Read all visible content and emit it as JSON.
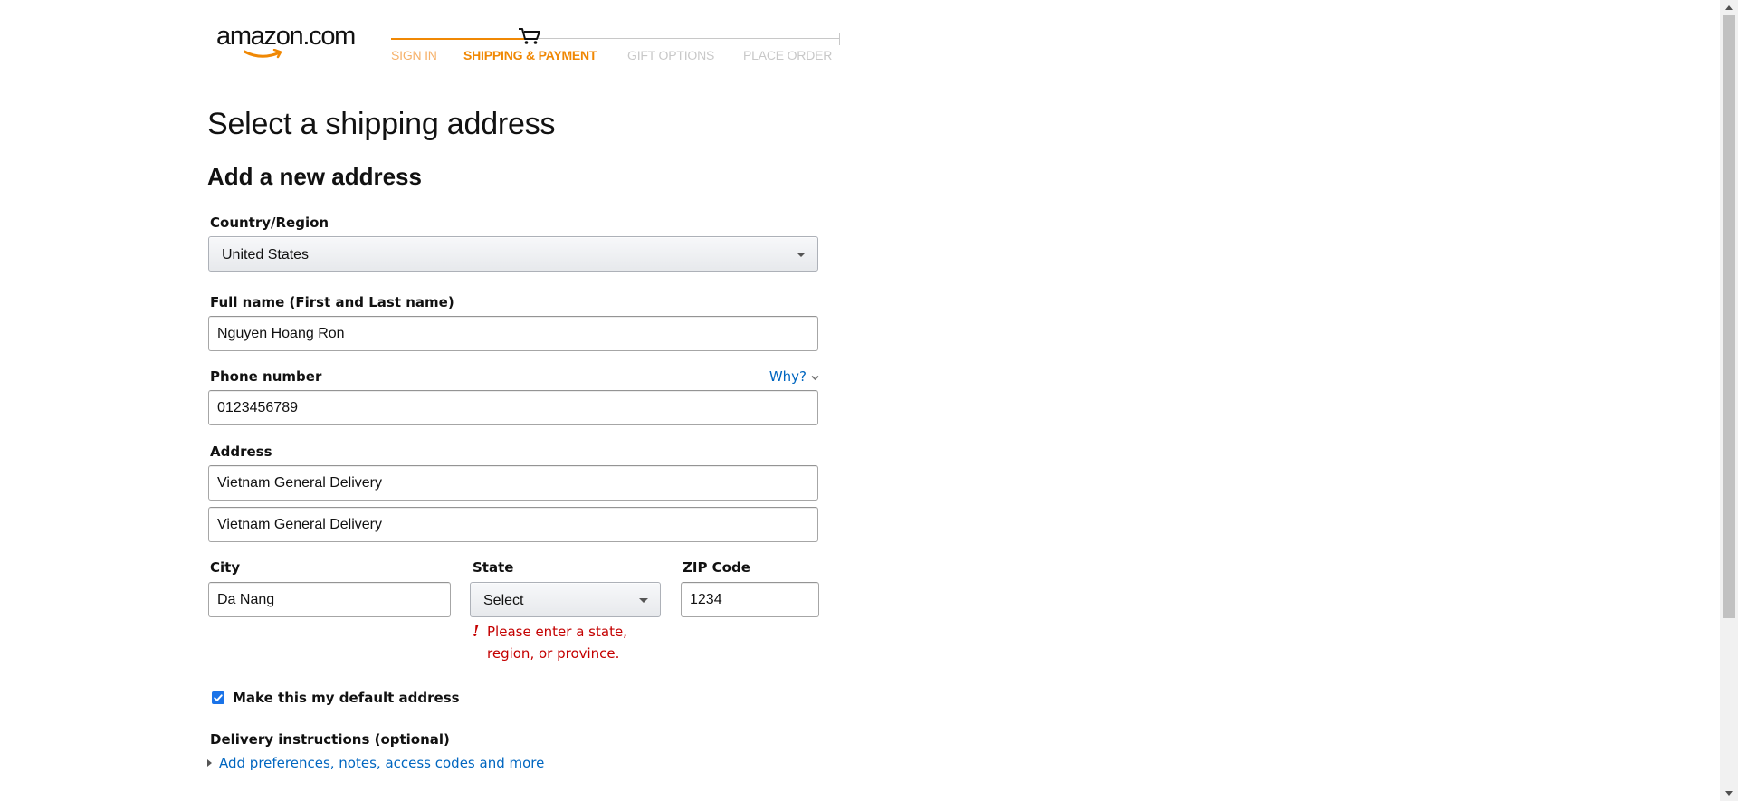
{
  "header": {
    "logo_text": "amazon.com",
    "steps": [
      "SIGN IN",
      "SHIPPING & PAYMENT",
      "GIFT OPTIONS",
      "PLACE ORDER"
    ],
    "cart_icon": "cart-icon"
  },
  "page": {
    "title": "Select a shipping address",
    "subtitle": "Add a new address"
  },
  "form": {
    "country": {
      "label": "Country/Region",
      "value": "United States"
    },
    "full_name": {
      "label": "Full name (First and Last name)",
      "value": "Nguyen Hoang Ron"
    },
    "phone": {
      "label": "Phone number",
      "value": "0123456789",
      "help_link": "Why?"
    },
    "address": {
      "label": "Address",
      "line1": "Vietnam General Delivery",
      "line2": "Vietnam General Delivery"
    },
    "city": {
      "label": "City",
      "value": "Da Nang"
    },
    "state": {
      "label": "State",
      "value": "Select",
      "error": "Please enter a state, region, or province."
    },
    "zip": {
      "label": "ZIP Code",
      "value": "1234"
    },
    "default_address": {
      "label": "Make this my default address",
      "checked": true
    },
    "delivery": {
      "label": "Delivery instructions (optional)",
      "link": "Add preferences, notes, access codes and more"
    }
  },
  "colors": {
    "accent": "#f08804",
    "link": "#0066c0",
    "error": "#c40000",
    "checkbox": "#1a73e8"
  }
}
